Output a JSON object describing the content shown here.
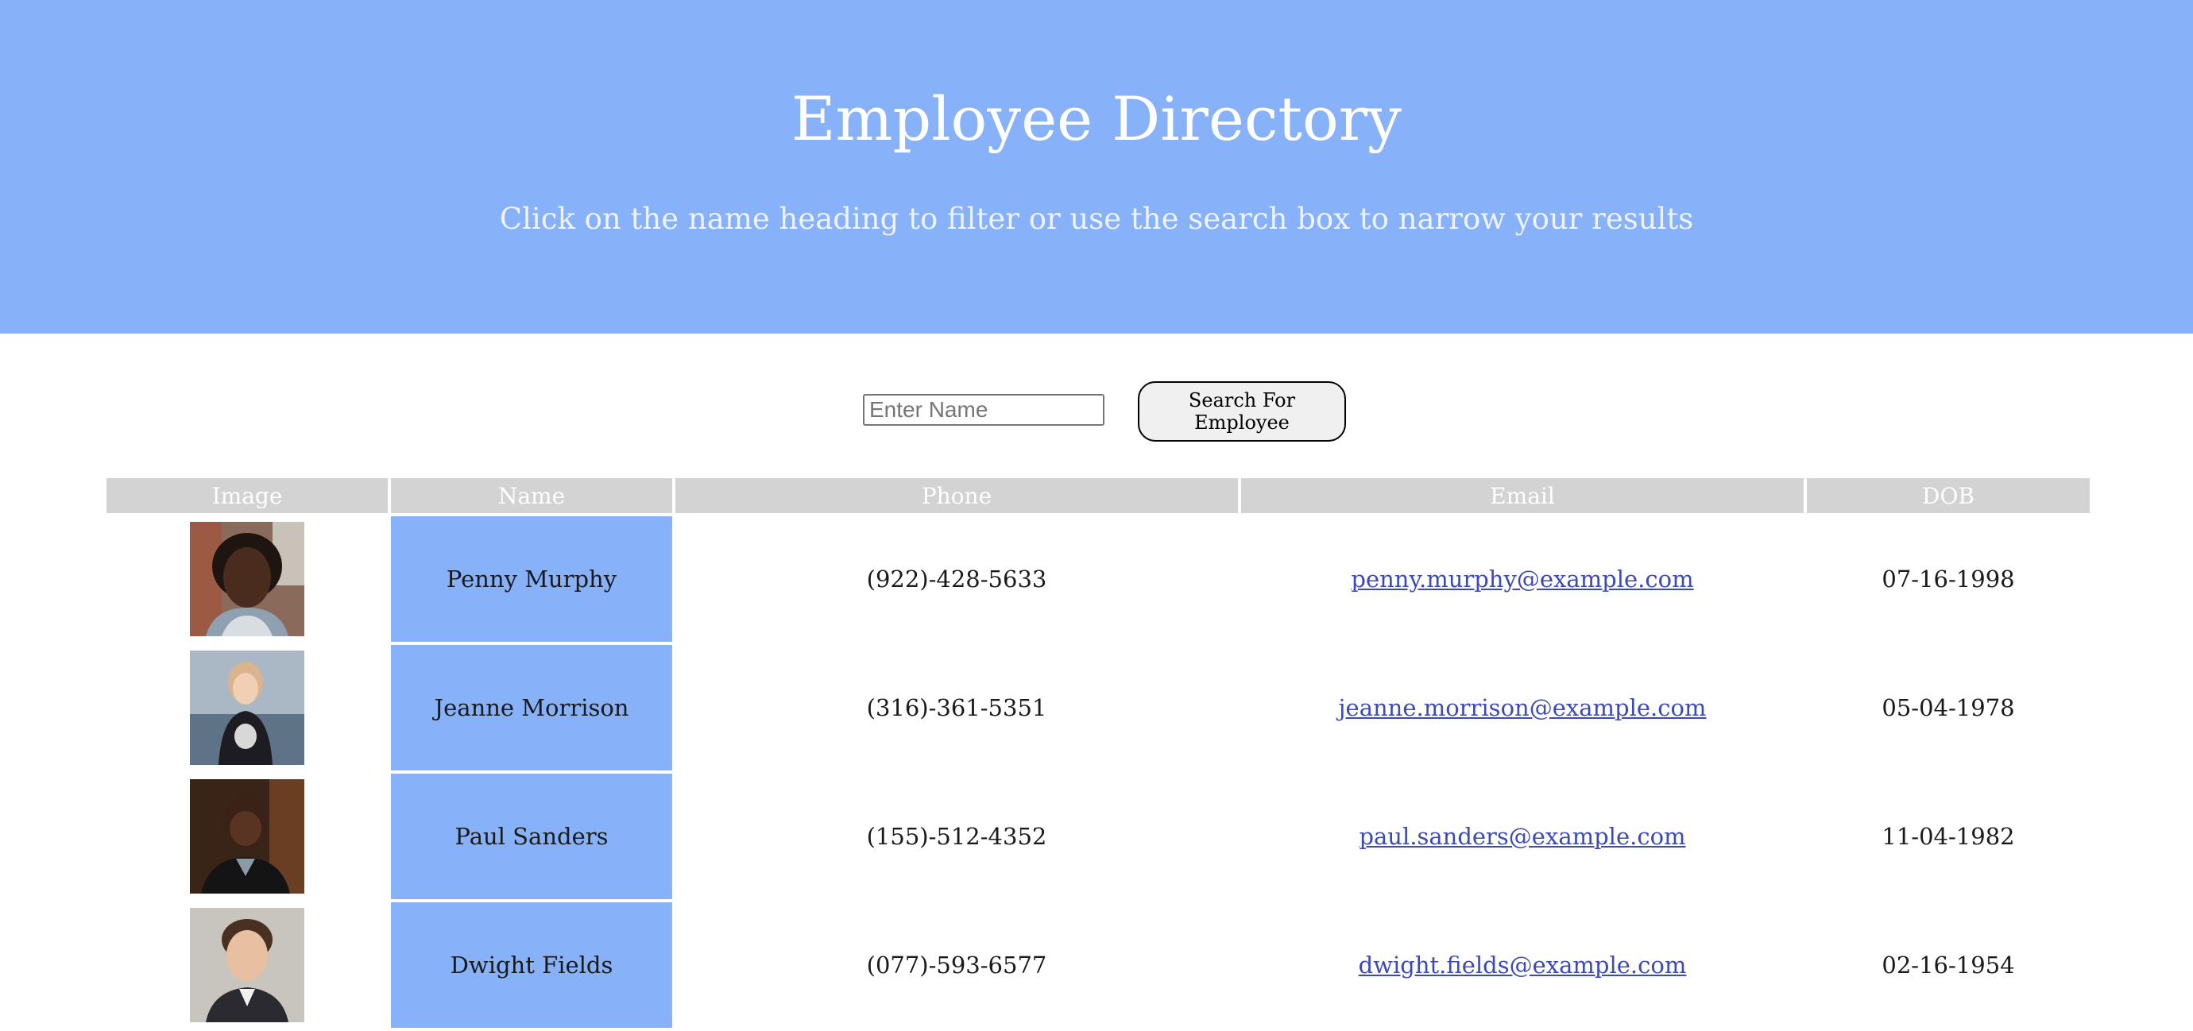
{
  "header": {
    "title": "Employee Directory",
    "subtitle": "Click on the name heading to filter or use the search box to narrow your results"
  },
  "search": {
    "placeholder": "Enter Name",
    "value": "",
    "button_label": "Search For Employee"
  },
  "table": {
    "columns": [
      "Image",
      "Name",
      "Phone",
      "Email",
      "DOB"
    ],
    "rows": [
      {
        "image": "employee-photo",
        "name": "Penny Murphy",
        "phone": "(922)-428-5633",
        "email": "penny.murphy@example.com",
        "dob": "07-16-1998"
      },
      {
        "image": "employee-photo",
        "name": "Jeanne Morrison",
        "phone": "(316)-361-5351",
        "email": "jeanne.morrison@example.com",
        "dob": "05-04-1978"
      },
      {
        "image": "employee-photo",
        "name": "Paul Sanders",
        "phone": "(155)-512-4352",
        "email": "paul.sanders@example.com",
        "dob": "11-04-1982"
      },
      {
        "image": "employee-photo",
        "name": "Dwight Fields",
        "phone": "(077)-593-6577",
        "email": "dwight.fields@example.com",
        "dob": "02-16-1954"
      }
    ]
  },
  "colors": {
    "accent": "#87b1f8",
    "header_cell": "#d3d3d3",
    "link": "#3b4ab8"
  }
}
